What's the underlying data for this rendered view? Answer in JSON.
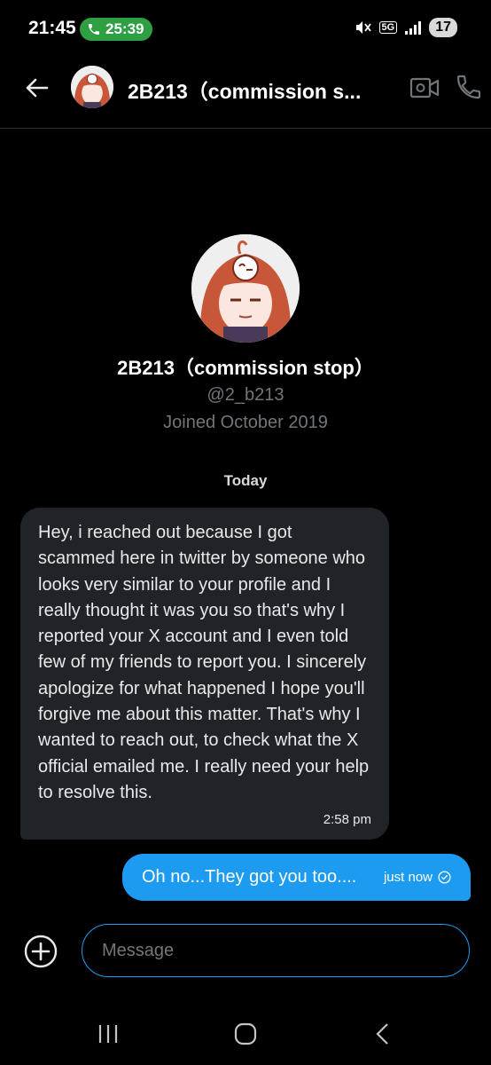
{
  "status_bar": {
    "time": "21:45",
    "call_timer": "25:39",
    "network": "5G",
    "battery": "17"
  },
  "header": {
    "title": "2B213（commission s..."
  },
  "profile": {
    "name": "2B213（commission stop）",
    "handle": "@2_b213",
    "joined": "Joined October 2019"
  },
  "thread": {
    "day_label": "Today",
    "messages": [
      {
        "direction": "incoming",
        "text": "Hey, i reached out because I got scammed here in twitter by someone who looks very similar to your profile and I really thought it was you so that's why I reported your X account and I even told few of my friends to report you. I sincerely apologize for what happened I hope you'll forgive me about this matter. That's why I wanted to reach out, to check what the X official emailed me. I really need your help to resolve this.",
        "time": "2:58 pm"
      },
      {
        "direction": "outgoing",
        "text": "Oh no...They got you too....",
        "time": "just now"
      }
    ]
  },
  "composer": {
    "placeholder": "Message"
  },
  "colors": {
    "accent": "#1d9bf0",
    "incoming_bubble": "#202327",
    "call_pill": "#2ea043"
  }
}
